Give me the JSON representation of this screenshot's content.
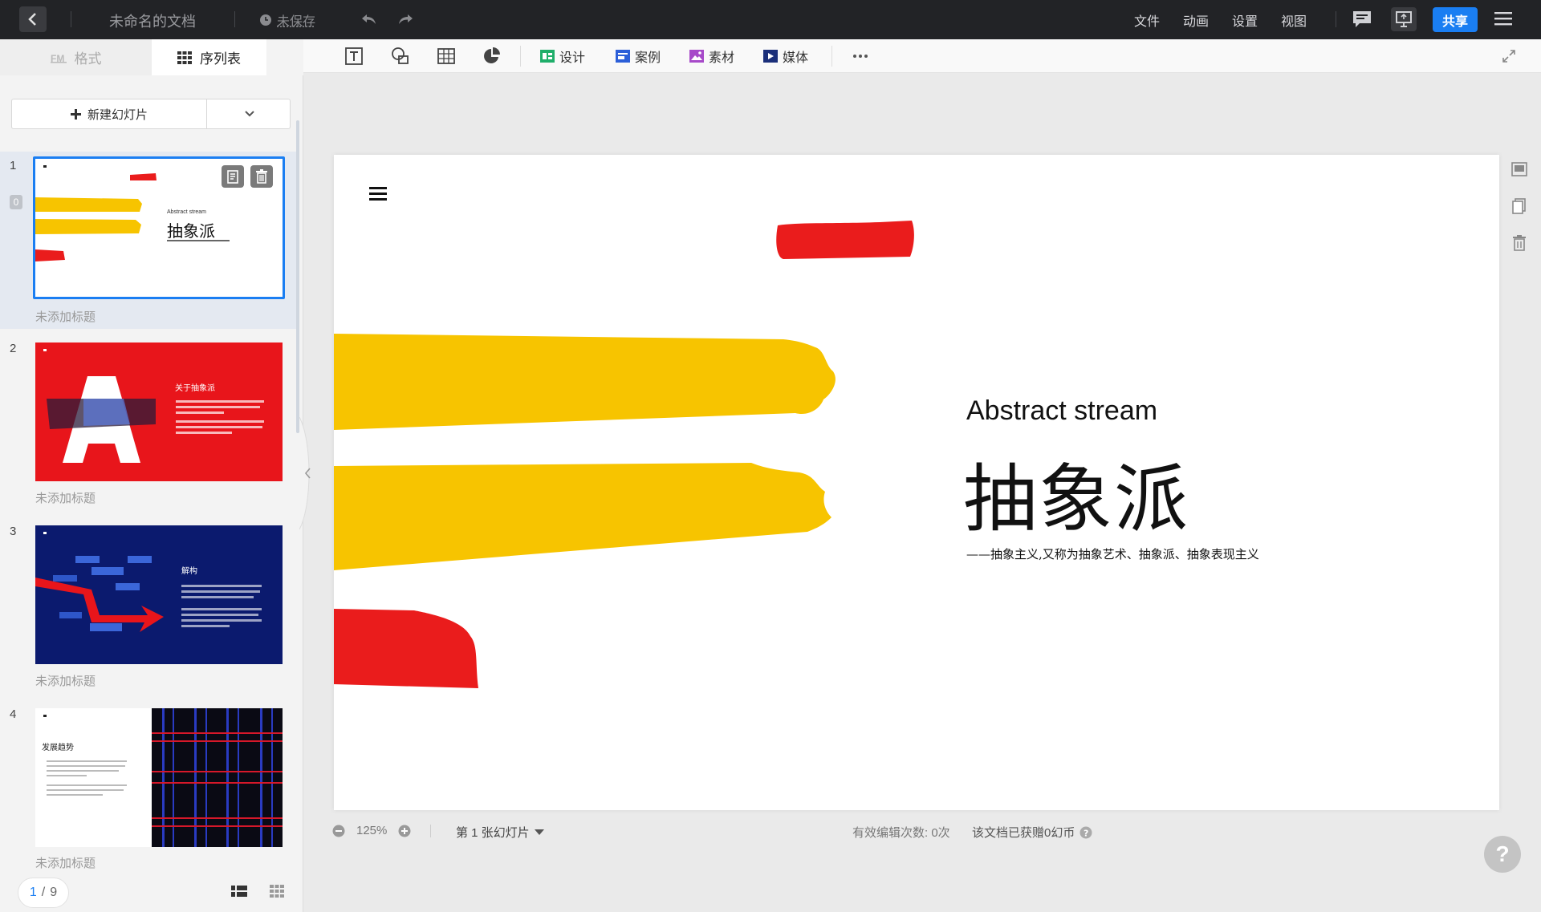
{
  "topbar": {
    "doc_title": "未命名的文档",
    "save_status": "未保存",
    "menus": [
      "文件",
      "动画",
      "设置",
      "视图"
    ],
    "share_label": "共享"
  },
  "left_panel": {
    "tab_format": "格式",
    "tab_list": "序列表",
    "new_slide_label": "新建幻灯片",
    "slides": [
      {
        "number": "1",
        "caption": "未添加标题",
        "comment_count": "0",
        "thumb": {
          "en": "Abstract stream",
          "cn": "抽象派"
        }
      },
      {
        "number": "2",
        "caption": "未添加标题",
        "thumb": {
          "title": "关于抽象派"
        }
      },
      {
        "number": "3",
        "caption": "未添加标题",
        "thumb": {
          "title": "解构"
        }
      },
      {
        "number": "4",
        "caption": "未添加标题",
        "thumb": {
          "title": "发展趋势"
        }
      }
    ],
    "pager": {
      "current": "1",
      "sep": "/",
      "total": "9"
    }
  },
  "toolbar": {
    "design": "设计",
    "case": "案例",
    "material": "素材",
    "media": "媒体"
  },
  "slide": {
    "subtitle_en": "Abstract stream",
    "title_cn": "抽象派",
    "description": "——抽象主义,又称为抽象艺术、抽象派、抽象表现主义"
  },
  "status": {
    "zoom": "125%",
    "slide_indicator": "第 1 张幻灯片",
    "edit_count": "有效编辑次数: 0次",
    "coins": "该文档已获赠0幻币"
  },
  "help_label": "?",
  "colors": {
    "accent": "#1a7ef2",
    "topbar_bg": "#222326",
    "brush_yellow": "#f7c400",
    "brush_red": "#ea1c1c"
  }
}
